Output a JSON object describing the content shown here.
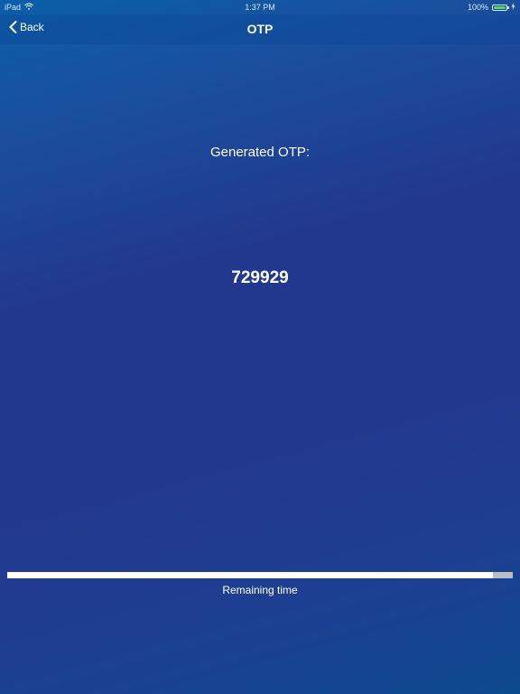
{
  "status_bar": {
    "device": "iPad",
    "time": "1:37 PM",
    "battery": "100%",
    "battery_level": 1.0,
    "icons": [
      "wifi-icon",
      "battery-icon",
      "charging-icon"
    ]
  },
  "nav": {
    "back_label": "Back",
    "title": "OTP",
    "back_icon": "chevron-left-icon"
  },
  "main": {
    "label": "Generated OTP:",
    "code": "729929"
  },
  "timer": {
    "remaining_fraction": 0.96,
    "label": "Remaining time"
  },
  "colors": {
    "background_top": "#0a5fa8",
    "background_mid": "#22388f",
    "text": "#ffffff",
    "progress_fill": "#ffffff",
    "progress_track": "#b8bec8",
    "battery_fill": "#4cd964"
  }
}
